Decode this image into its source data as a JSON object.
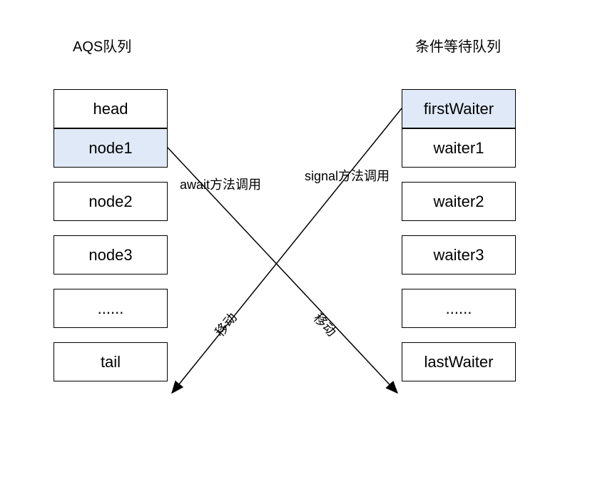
{
  "titles": {
    "left": "AQS队列",
    "right": "条件等待队列"
  },
  "leftQueue": {
    "items": [
      "head",
      "node1",
      "node2",
      "node3",
      "......",
      "tail"
    ],
    "highlightIndex": 1
  },
  "rightQueue": {
    "items": [
      "firstWaiter",
      "waiter1",
      "waiter2",
      "waiter3",
      "......",
      "lastWaiter"
    ],
    "highlightIndex": 0
  },
  "labels": {
    "await": "await方法调用",
    "signal": "signal方法调用",
    "moveLeft": "移动",
    "moveRight": "移动"
  }
}
